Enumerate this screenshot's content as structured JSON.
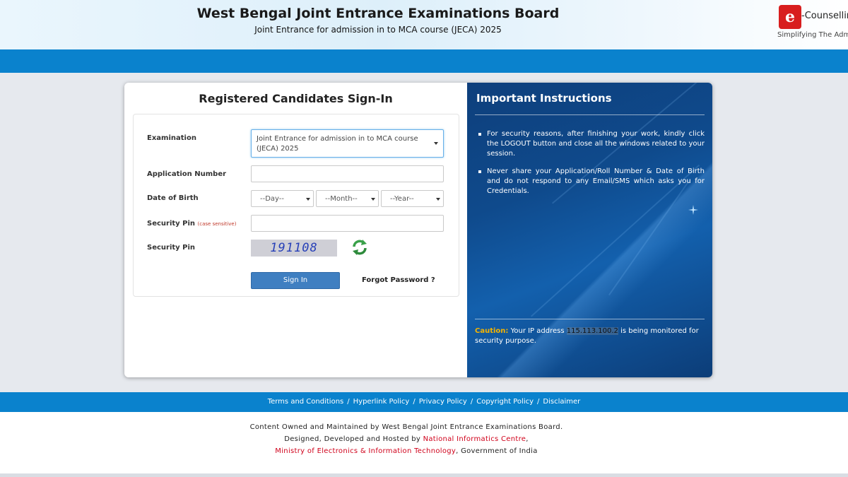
{
  "header": {
    "title": "West Bengal Joint Entrance Examinations Board",
    "subtitle": "Joint Entrance for admission in to MCA course (JECA) 2025",
    "logo_mark": "e",
    "logo_text": "-Counselling",
    "logo_tagline": "Simplifying The Admis"
  },
  "signin": {
    "title": "Registered Candidates Sign-In",
    "examination_label": "Examination",
    "examination_value": "Joint Entrance for admission in to MCA course (JECA) 2025",
    "application_number_label": "Application Number",
    "application_number_value": "",
    "dob_label": "Date of Birth",
    "dob_day": "--Day--",
    "dob_month": "--Month--",
    "dob_year": "--Year--",
    "security_pin_label": "Security Pin",
    "security_pin_note": "(case sensitive)",
    "security_pin_value": "",
    "captcha_label": "Security Pin",
    "captcha_code": "191108",
    "signin_button": "Sign In",
    "forgot_password": "Forgot Password ?"
  },
  "instructions": {
    "title": "Important Instructions",
    "items": [
      "For security reasons, after finishing your work, kindly click the LOGOUT button and close all the windows related to your session.",
      "Never share your Application/Roll Number & Date of Birth and do not respond to any Email/SMS which asks you for Credentials."
    ],
    "caution_label": "Caution:",
    "caution_text_1": " Your IP address ",
    "caution_ip": "115.113.100.2",
    "caution_text_2": " is being monitored for security purpose."
  },
  "footer": {
    "links": [
      "Terms and Conditions",
      "Hyperlink Policy",
      "Privacy Policy",
      "Copyright Policy",
      "Disclaimer"
    ],
    "separator": "/",
    "line1": "Content Owned and Maintained by West Bengal Joint Entrance Examinations Board.",
    "line2_prefix": "Designed, Developed and Hosted by ",
    "line2_link": "National Informatics Centre",
    "line2_suffix": ",",
    "line3_link": "Ministry of Electronics & Information Technology",
    "line3_suffix": ", Government of India"
  },
  "colors": {
    "brand_blue": "#0a82cd",
    "panel_blue": "#0f4a8c",
    "caution_yellow": "#f5b400",
    "link_red": "#d0021b"
  }
}
